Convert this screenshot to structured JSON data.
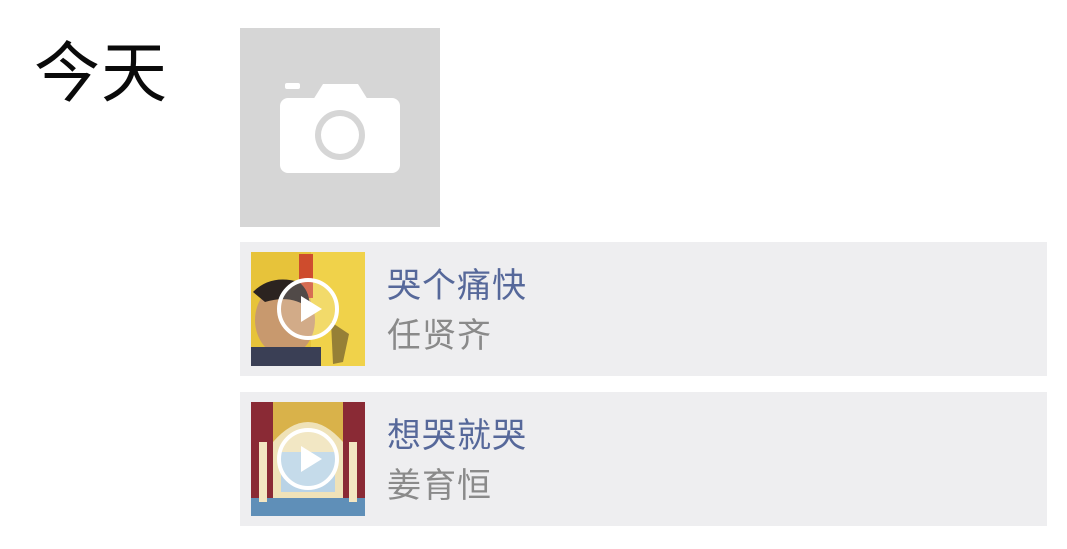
{
  "day": {
    "label": "今天"
  },
  "photo": {
    "icon": "camera-icon"
  },
  "music": [
    {
      "title": "哭个痛快",
      "artist": "任贤齐",
      "play_icon": "play-icon"
    },
    {
      "title": "想哭就哭",
      "artist": "姜育恒",
      "play_icon": "play-icon"
    }
  ],
  "colors": {
    "title": "#56689a",
    "artist": "#8a8a8a",
    "card_bg": "#eeeef0",
    "placeholder_bg": "#d6d6d6"
  }
}
